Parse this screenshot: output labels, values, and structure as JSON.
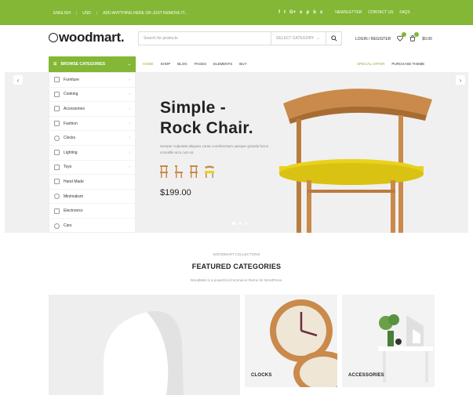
{
  "topbar": {
    "language": "ENGLISH",
    "currency": "USD",
    "promo": "ADD ANYTHING HERE OR JUST REMOVE IT...",
    "social_icons": [
      "f",
      "t",
      "G+",
      "e",
      "p",
      "b",
      "s"
    ],
    "links": [
      "NEWSLETTER",
      "CONTACT US",
      "FAQS"
    ]
  },
  "header": {
    "logo": "woodmart.",
    "search_placeholder": "Search for products",
    "category_select": "SELECT CATEGORY",
    "login": "LOGIN / REGISTER",
    "cart_total": "$0.00"
  },
  "nav": {
    "browse_label": "BROWSE CATEGORIES",
    "items": [
      "HOME",
      "SHOP",
      "BLOG",
      "PAGES",
      "ELEMENTS",
      "BUY"
    ],
    "right": [
      "SPECIAL OFFER",
      "PURCHASE THEME"
    ]
  },
  "sidebar": {
    "items": [
      {
        "label": "Furniture",
        "has_sub": true
      },
      {
        "label": "Cooking",
        "has_sub": true
      },
      {
        "label": "Accessories",
        "has_sub": true
      },
      {
        "label": "Fashion",
        "has_sub": true
      },
      {
        "label": "Clocks",
        "has_sub": true
      },
      {
        "label": "Lighting",
        "has_sub": true
      },
      {
        "label": "Toys",
        "has_sub": true
      },
      {
        "label": "Hand Made",
        "has_sub": false
      },
      {
        "label": "Minimalism",
        "has_sub": false
      },
      {
        "label": "Electronics",
        "has_sub": false
      },
      {
        "label": "Cars",
        "has_sub": false
      }
    ]
  },
  "hero": {
    "title_line1": "Simple -",
    "title_line2": "Rock Chair.",
    "description": "Semper vulputate aliquam curae condimentum quisque gravida fusce convallis arcu cum at.",
    "price": "$199.00",
    "prev_arrow": "‹",
    "next_arrow": "›"
  },
  "featured": {
    "supertitle": "WOODMART COLLECTIONS",
    "title": "FEATURED CATEGORIES",
    "description": "WoodMart is a powerful eCommerce theme for WordPress.",
    "cards": [
      {
        "label": ""
      },
      {
        "label": "CLOCKS"
      },
      {
        "label": "ACCESSORIES"
      }
    ]
  },
  "colors": {
    "accent": "#83b735",
    "chair_seat": "#e8d21e",
    "wood": "#c98a4b"
  }
}
